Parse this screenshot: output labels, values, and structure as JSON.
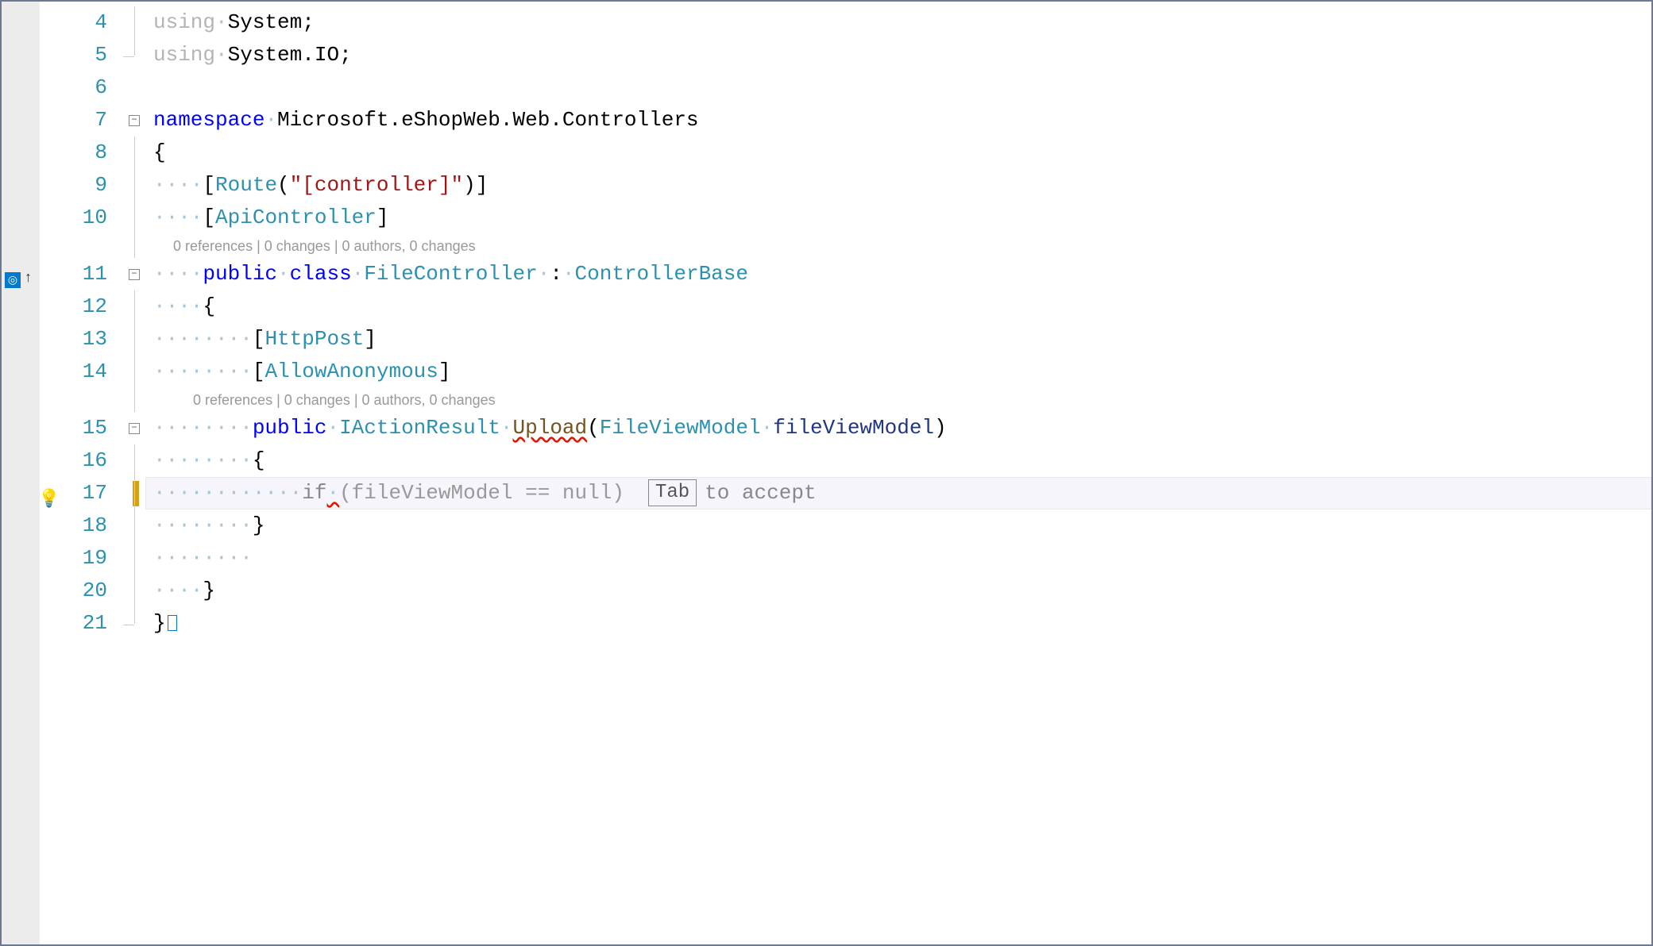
{
  "lines": {
    "4": {
      "num": "4"
    },
    "5": {
      "num": "5"
    },
    "6": {
      "num": "6"
    },
    "7": {
      "num": "7"
    },
    "8": {
      "num": "8"
    },
    "9": {
      "num": "9"
    },
    "10": {
      "num": "10"
    },
    "11": {
      "num": "11"
    },
    "12": {
      "num": "12"
    },
    "13": {
      "num": "13"
    },
    "14": {
      "num": "14"
    },
    "15": {
      "num": "15"
    },
    "16": {
      "num": "16"
    },
    "17": {
      "num": "17"
    },
    "18": {
      "num": "18"
    },
    "19": {
      "num": "19"
    },
    "20": {
      "num": "20"
    },
    "21": {
      "num": "21"
    }
  },
  "tokens": {
    "using1": "using",
    "using2": "using",
    "system": "System",
    "systemio": "System.IO",
    "semi": ";",
    "namespace": "namespace",
    "ns_name": "Microsoft.eShopWeb.Web.Controllers",
    "lbrace": "{",
    "rbrace": "}",
    "lbracket": "[",
    "rbracket": "]",
    "lparen": "(",
    "rparen": ")",
    "route": "Route",
    "route_str": "\"[controller]\"",
    "apicontroller": "ApiController",
    "public": "public",
    "class": "class",
    "filecontroller": "FileController",
    "colon": ":",
    "controllerbase": "ControllerBase",
    "httppost": "HttpPost",
    "allowanon": "AllowAnonymous",
    "iactionresult": "IActionResult",
    "upload": "Upload",
    "fileviewmodel_t": "FileViewModel",
    "fileviewmodel_p": "fileViewModel",
    "if": "if",
    "suggestion_cond": "(fileViewModel == null)",
    "dot1": "·",
    "dots4": "····",
    "dots8": "········",
    "dots12": "············"
  },
  "codelens": {
    "class_text": "0 references | 0 changes | 0 authors, 0 changes",
    "method_text": "0 references | 0 changes | 0 authors, 0 changes"
  },
  "hint": {
    "tab": "Tab",
    "accept": "to accept"
  },
  "fold": {
    "minus": "−"
  }
}
